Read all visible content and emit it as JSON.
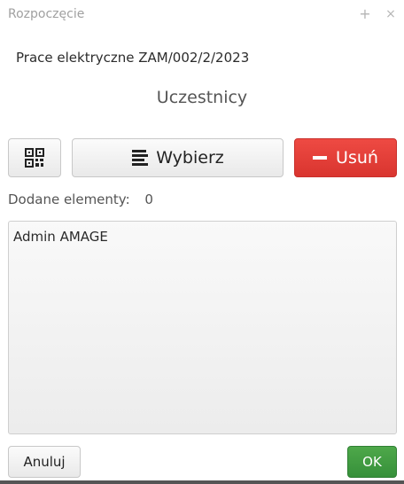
{
  "window": {
    "title": "Rozpoczęcie",
    "add_label": "+",
    "close_label": "×"
  },
  "header": {
    "subtitle": "Prace elektryczne ZAM/002/2/2023",
    "section_title": "Uczestnicy"
  },
  "toolbar": {
    "qr_icon": "qr-code-icon",
    "choose_label": "Wybierz",
    "choose_icon": "list-icon",
    "remove_label": "Usuń",
    "remove_icon": "minus-icon",
    "remove_color": "#e0413b"
  },
  "counter": {
    "label": "Dodane elementy:",
    "value": "0"
  },
  "list": {
    "items": [
      "Admin AMAGE"
    ]
  },
  "footer": {
    "cancel_label": "Anuluj",
    "ok_label": "OK",
    "ok_color": "#3f9b42"
  }
}
